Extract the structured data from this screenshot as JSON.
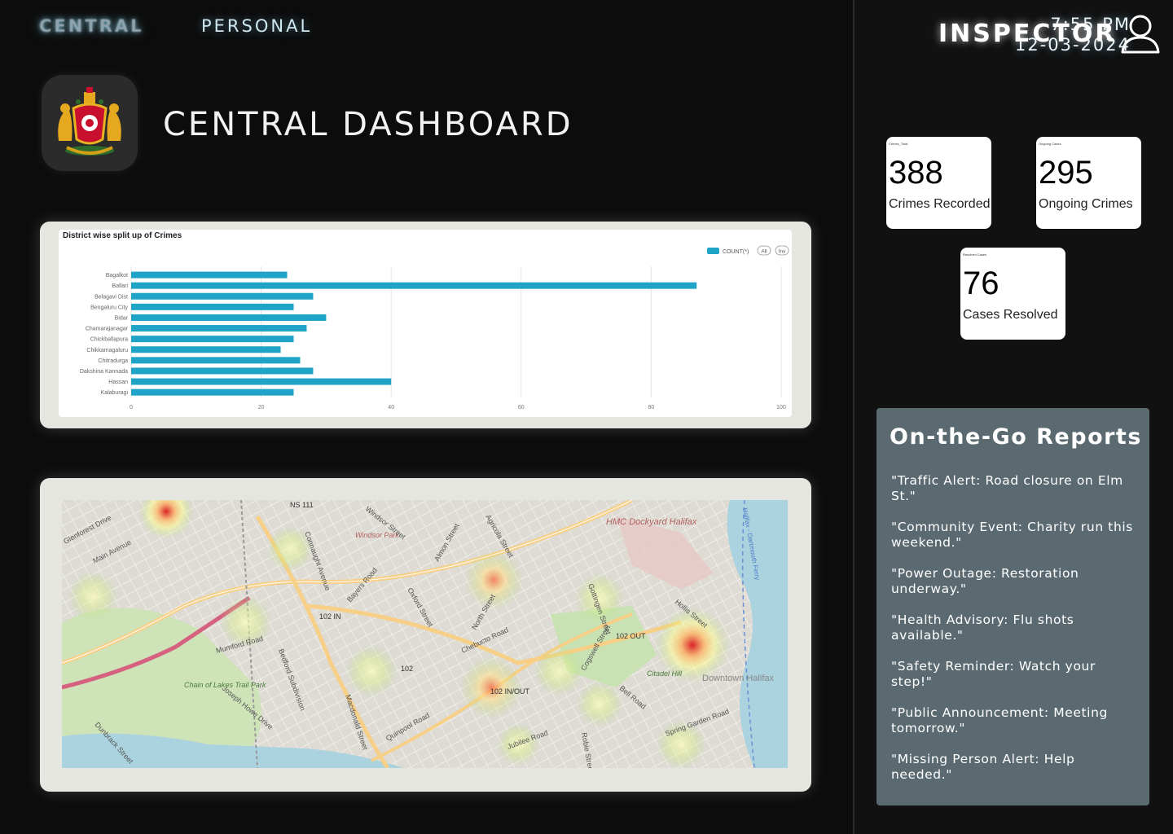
{
  "nav": {
    "tab_central": "CENTRAL",
    "tab_personal": "PERSONAL",
    "time": "7:55 PM",
    "date": "12-03-2024"
  },
  "header": {
    "title": "CENTRAL DASHBOARD",
    "emblem_icon": "karnataka-emblem-icon"
  },
  "user": {
    "role": "INSPECTOR",
    "icon": "user-profile-icon"
  },
  "stats": [
    {
      "small_title": "Crimes_Total",
      "value": "388",
      "label": "Crimes Recorded"
    },
    {
      "small_title": "Ongoing Cases",
      "value": "295",
      "label": "Ongoing Crimes"
    },
    {
      "small_title": "Resolved Cases",
      "value": "76",
      "label": "Cases Resolved"
    }
  ],
  "chart_data": {
    "type": "bar",
    "orientation": "horizontal",
    "title": "District wise split up of Crimes",
    "legend": {
      "label": "COUNT(*)",
      "buttons": [
        "All",
        "Inv"
      ],
      "position": "top-right"
    },
    "color": "#1fa4c8",
    "categories": [
      "Bagalkot",
      "Ballari",
      "Belagavi Dist",
      "Bengaluru City",
      "Bidar",
      "Chamarajanagar",
      "Chickballapura",
      "Chikkamagaluru",
      "Chitradurga",
      "Dakshina Kannada",
      "Hassan",
      "Kalaburagi"
    ],
    "values": [
      24,
      87,
      28,
      25,
      30,
      27,
      25,
      23,
      26,
      28,
      40,
      25
    ],
    "xticks": [
      "0",
      "20",
      "40",
      "60",
      "80",
      "100"
    ],
    "xlim": [
      0,
      100
    ],
    "grid": true
  },
  "map": {
    "labels": [
      "NS 111",
      "Windsor Park",
      "HMC Dockyard Halifax",
      "Halifax - Dartmouth Ferry",
      "102 IN",
      "102 OUT",
      "102",
      "102 IN/OUT",
      "Citadel Hill",
      "Downtown Halifax",
      "Chain of Lakes Trail Park",
      "Glenforest Drive",
      "Main Avenue",
      "Mumford Road",
      "Joseph Howe Drive",
      "Bedford Subdivision",
      "Connaught Avenue",
      "Windsor Street",
      "Agricola Street",
      "Robie Street",
      "Oxford Street",
      "North Street",
      "Chebucto Road",
      "Quinpool Road",
      "Jubilee Road",
      "Dunbrack Street",
      "Bayers Road",
      "Cogswell Street",
      "Bell Road",
      "Spring Garden Road",
      "Gottingen Street",
      "Almon Street",
      "Macdonald Street",
      "Hollis Street"
    ],
    "hotspots": [
      {
        "name": "hotspot-north-west",
        "intensity": "high"
      },
      {
        "name": "hotspot-almon",
        "intensity": "medium"
      },
      {
        "name": "hotspot-downtown",
        "intensity": "high"
      },
      {
        "name": "hotspot-chebucto",
        "intensity": "medium"
      }
    ]
  },
  "reports": {
    "title": "On-the-Go Reports",
    "items": [
      "\"Traffic Alert: Road closure on Elm St.\"",
      "\"Community Event: Charity run this weekend.\"",
      "\"Power Outage: Restoration underway.\"",
      "\"Health Advisory: Flu shots available.\"",
      "\"Safety Reminder: Watch your step!\"",
      "\"Public Announcement: Meeting tomorrow.\"",
      "\"Missing Person Alert: Help needed.\""
    ]
  }
}
